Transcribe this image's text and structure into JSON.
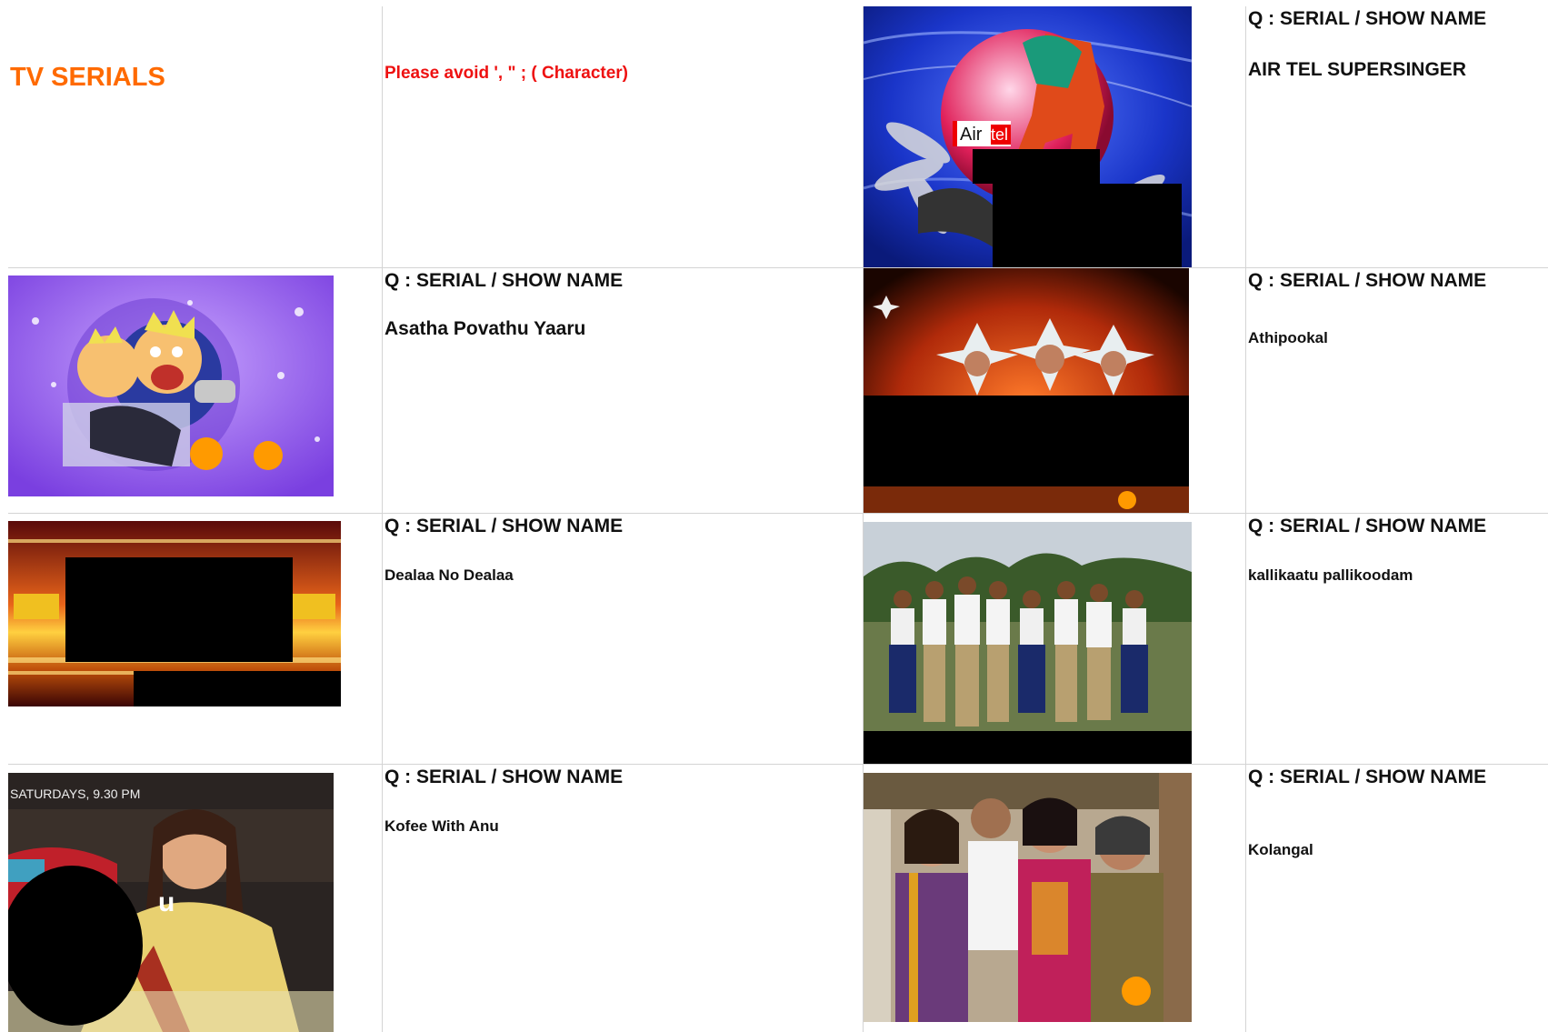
{
  "header": {
    "title": "TV SERIALS",
    "note": "Please avoid ', \" ; ( Character)"
  },
  "question_label": "Q : SERIAL / SHOW NAME",
  "shows": [
    {
      "name": "AIR TEL SUPERSINGER",
      "logo_text_1": "Air",
      "logo_text_2": "tel"
    },
    {
      "name": "Asatha Povathu Yaaru"
    },
    {
      "name": "Athipookal"
    },
    {
      "name": "Dealaa No Dealaa"
    },
    {
      "name": "kallikaatu pallikoodam"
    },
    {
      "name": "Kofee With Anu",
      "image_text": "SATURDAYS, 9.30 PM"
    },
    {
      "name": "Kolangal"
    }
  ],
  "colors": {
    "title": "#ff6a00",
    "note": "#ee1111",
    "grid": "#d4d4d4"
  }
}
